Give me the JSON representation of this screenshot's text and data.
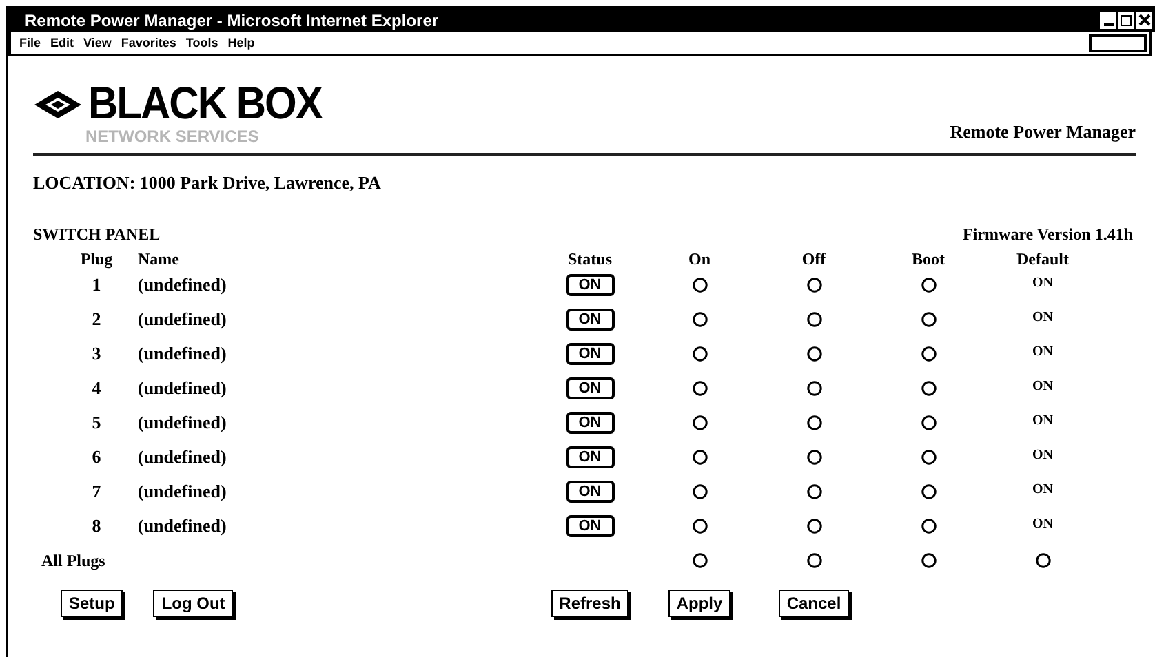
{
  "window": {
    "title": "Remote Power Manager - Microsoft Internet Explorer"
  },
  "menu": [
    "File",
    "Edit",
    "View",
    "Favorites",
    "Tools",
    "Help"
  ],
  "logo": {
    "name": "BLACK BOX",
    "tagline": "NETWORK SERVICES"
  },
  "page_title": "Remote Power Manager",
  "location": "LOCATION: 1000 Park Drive, Lawrence, PA",
  "panel_title": "SWITCH PANEL",
  "firmware": "Firmware Version 1.41h",
  "columns": [
    "Plug",
    "Name",
    "Status",
    "On",
    "Off",
    "Boot",
    "Default"
  ],
  "rows": [
    {
      "plug": "1",
      "name": "(undefined)",
      "status": "ON",
      "on": false,
      "off": false,
      "boot": false,
      "default": "ON"
    },
    {
      "plug": "2",
      "name": "(undefined)",
      "status": "ON",
      "on": false,
      "off": false,
      "boot": false,
      "default": "ON"
    },
    {
      "plug": "3",
      "name": "(undefined)",
      "status": "ON",
      "on": false,
      "off": false,
      "boot": false,
      "default": "ON"
    },
    {
      "plug": "4",
      "name": "(undefined)",
      "status": "ON",
      "on": false,
      "off": false,
      "boot": false,
      "default": "ON"
    },
    {
      "plug": "5",
      "name": "(undefined)",
      "status": "ON",
      "on": false,
      "off": false,
      "boot": false,
      "default": "ON"
    },
    {
      "plug": "6",
      "name": "(undefined)",
      "status": "ON",
      "on": false,
      "off": false,
      "boot": false,
      "default": "ON"
    },
    {
      "plug": "7",
      "name": "(undefined)",
      "status": "ON",
      "on": false,
      "off": false,
      "boot": false,
      "default": "ON"
    },
    {
      "plug": "8",
      "name": "(undefined)",
      "status": "ON",
      "on": false,
      "off": false,
      "boot": false,
      "default": "ON"
    }
  ],
  "all_plugs": {
    "label": "All Plugs",
    "on": false,
    "off": false,
    "boot": false,
    "default": false
  },
  "buttons_left": [
    "Setup",
    "Log Out"
  ],
  "buttons_right": [
    "Refresh",
    "Apply",
    "Cancel"
  ]
}
